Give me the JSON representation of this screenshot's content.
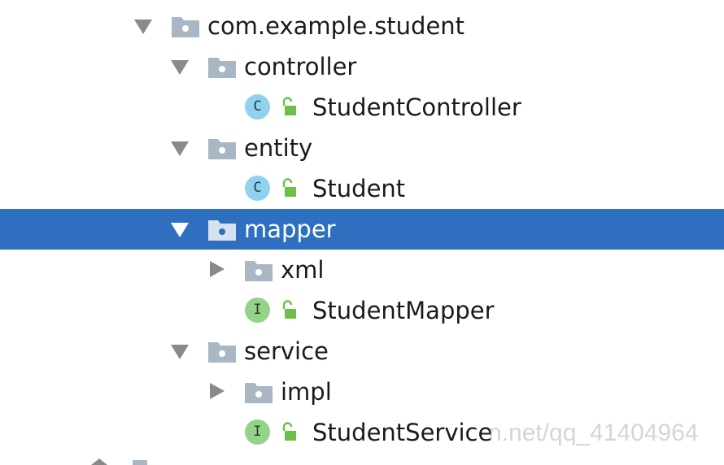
{
  "tree": {
    "rows": [
      {
        "label": "com.example.student",
        "kind": "package",
        "expanded": true,
        "depth": 0,
        "selected": false
      },
      {
        "label": "controller",
        "kind": "package",
        "expanded": true,
        "depth": 1,
        "selected": false
      },
      {
        "label": "StudentController",
        "kind": "class",
        "badge": "C",
        "depth": 2,
        "selected": false
      },
      {
        "label": "entity",
        "kind": "package",
        "expanded": true,
        "depth": 1,
        "selected": false
      },
      {
        "label": "Student",
        "kind": "class",
        "badge": "C",
        "depth": 2,
        "selected": false
      },
      {
        "label": "mapper",
        "kind": "package",
        "expanded": true,
        "depth": 1,
        "selected": true
      },
      {
        "label": "xml",
        "kind": "package",
        "expanded": false,
        "depth": 2,
        "selected": false
      },
      {
        "label": "StudentMapper",
        "kind": "interface",
        "badge": "I",
        "depth": 2,
        "selected": false
      },
      {
        "label": "service",
        "kind": "package",
        "expanded": true,
        "depth": 1,
        "selected": false
      },
      {
        "label": "impl",
        "kind": "package",
        "expanded": false,
        "depth": 2,
        "selected": false
      },
      {
        "label": "StudentService",
        "kind": "interface",
        "badge": "I",
        "depth": 2,
        "selected": false
      }
    ]
  },
  "watermark": "n.net/qq_41404964",
  "icons": {
    "folder": "package-folder-icon",
    "class": "class-icon",
    "interface": "interface-icon",
    "lock": "public-access-lock-icon",
    "expanded": "expand-arrow-down-icon",
    "collapsed": "collapse-arrow-right-icon"
  },
  "colors": {
    "selection": "#2f6fbf",
    "folder": "#a9b6c4",
    "class_badge": "#8fd1ee",
    "interface_badge": "#93d38a",
    "lock": "#6cc04a",
    "arrow": "#8a8a8a"
  }
}
